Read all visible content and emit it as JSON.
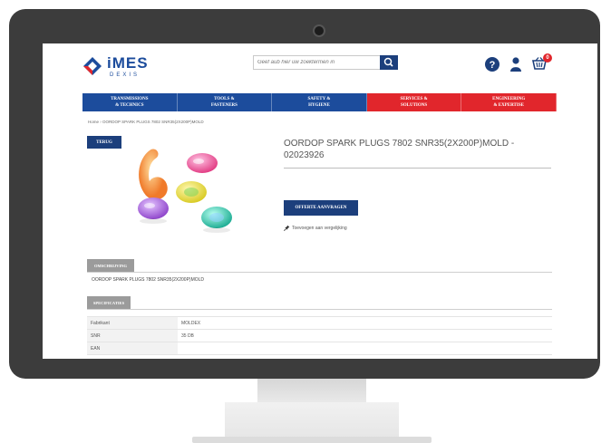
{
  "header": {
    "logo_name": "iMES",
    "logo_sub": "DEXIS",
    "search_placeholder": "Geef aub hier uw zoektermen in",
    "cart_count": "0"
  },
  "colors": {
    "brand_blue": "#1c4c9c",
    "nav_blue": "#1c4c9c",
    "nav_red": "#e1262c",
    "button_blue": "#1c3f7c",
    "tab_gray": "#9b9b9b"
  },
  "icons": {
    "logo": "diamond-logo-icon",
    "search": "search-icon",
    "help": "help-icon",
    "user": "user-icon",
    "cart": "cart-icon",
    "compare": "pin-icon"
  },
  "nav": [
    {
      "label": "TRANSMISSIONS\n& TECHNICS",
      "color": "#1c4c9c"
    },
    {
      "label": "TOOLS &\nFASTENERS",
      "color": "#1c4c9c"
    },
    {
      "label": "SAFETY &\nHYGIENE",
      "color": "#1c4c9c"
    },
    {
      "label": "SERVICES &\nSOLUTIONS",
      "color": "#e1262c"
    },
    {
      "label": "ENGINEERING\n& EXPERTISE",
      "color": "#e1262c"
    }
  ],
  "breadcrumb": "Home  ›  OORDOP SPARK PLUGS 7802 SNR35(2X200P)MOLD",
  "product": {
    "back_label": "TERUG",
    "title": "OORDOP SPARK PLUGS 7802 SNR35(2X200P)MOLD - 02023926",
    "quote_label": "OFFERTE AANVRAGEN",
    "compare_label": "Toevoegen aan vergelijking"
  },
  "description": {
    "tab_label": "OMSCHRIJVING",
    "text": "OORDOP SPARK PLUGS 7802 SNR35(2X200P)MOLD"
  },
  "specifications": {
    "tab_label": "SPECIFICATIES",
    "rows": [
      {
        "key": "Fabrikant",
        "value": "MOLDEX"
      },
      {
        "key": "SNR",
        "value": "35 DB"
      },
      {
        "key": "EAN",
        "value": ""
      }
    ]
  }
}
